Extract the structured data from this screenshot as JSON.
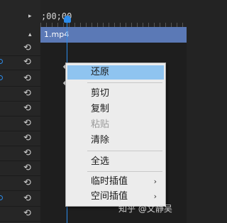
{
  "timeline": {
    "timecode": ";00;00",
    "clip_name": "1.mp4"
  },
  "left_panel": {
    "reset_glyph": "⟲",
    "rows": 14
  },
  "context_menu": {
    "items": [
      {
        "label": "还原",
        "highlighted": true,
        "enabled": true
      },
      {
        "label": "剪切",
        "enabled": true
      },
      {
        "label": "复制",
        "enabled": true
      },
      {
        "label": "粘贴",
        "enabled": false
      },
      {
        "label": "清除",
        "enabled": true
      },
      {
        "label": "全选",
        "enabled": true
      },
      {
        "label": "临时插值",
        "enabled": true,
        "submenu": true
      },
      {
        "label": "空间插值",
        "enabled": true,
        "submenu": true
      }
    ],
    "submenu_arrow": "›"
  },
  "watermark": "知乎 @文静吴",
  "colors": {
    "accent": "#2d8ceb",
    "clip": "#5b79b6",
    "highlight": "#8fc4f0"
  }
}
